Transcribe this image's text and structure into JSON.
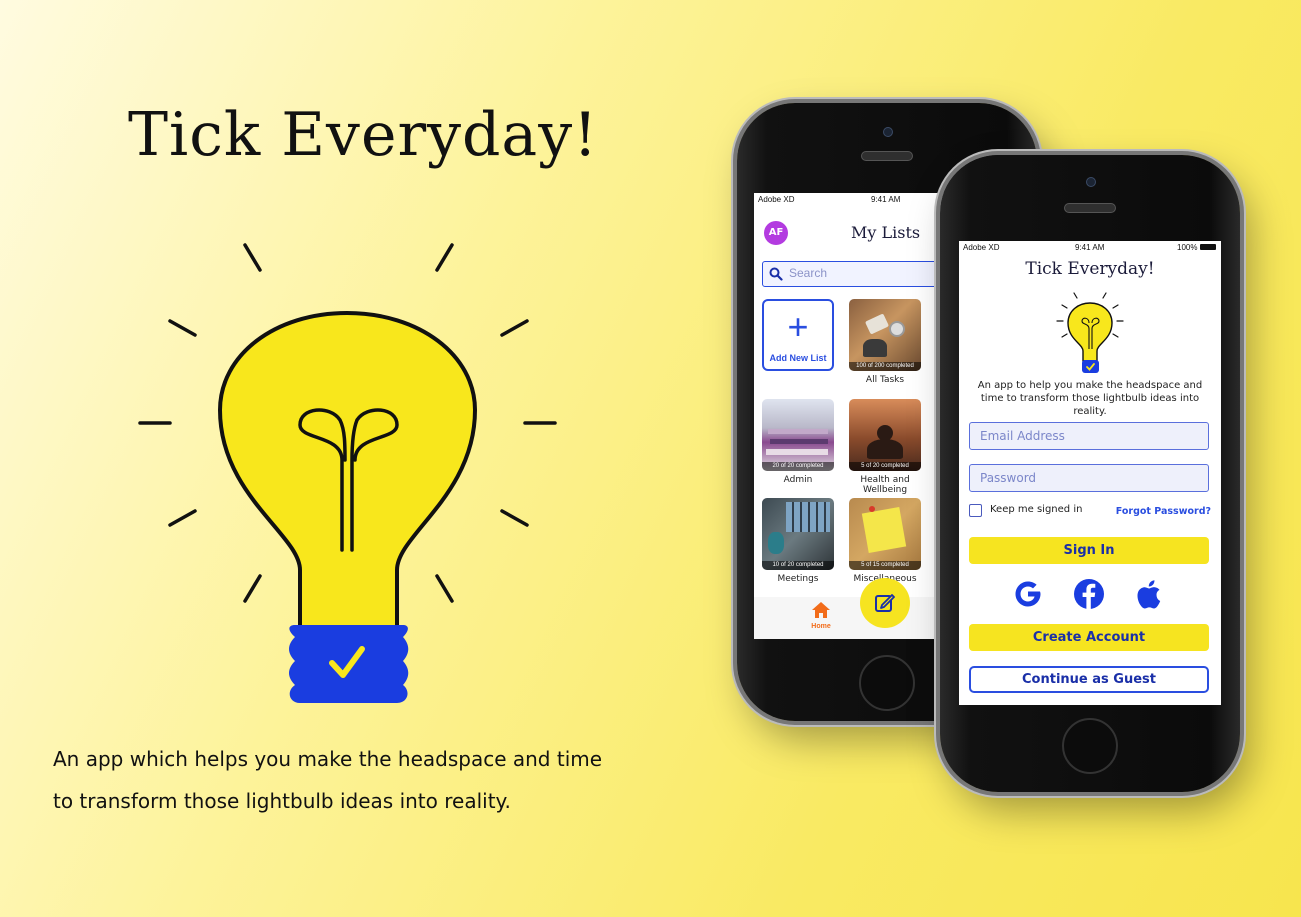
{
  "hero": {
    "title": "Tick Everyday!",
    "description_line1": "An app which helps you make the headspace and time",
    "description_line2": "to transform those lightbulb ideas into reality."
  },
  "colors": {
    "bulb_yellow": "#f8e71c",
    "bulb_base_blue": "#1a3de0",
    "accent_yellow": "#f6e420",
    "brand_blue": "#2a4ee0",
    "avatar_purple": "#b33be0",
    "home_orange": "#f26c1a"
  },
  "back_phone": {
    "status": {
      "carrier": "Adobe XD",
      "time": "9:41 AM"
    },
    "avatar_initials": "AF",
    "title": "My Lists",
    "search_placeholder": "Search",
    "add_new_list": "Add New List",
    "lists": [
      {
        "label": "All Tasks",
        "badge": "100 of 200 completed"
      },
      {
        "label": "Admin",
        "badge": "20 of 20 completed"
      },
      {
        "label": "Health and Wellbeing",
        "badge": "5 of 20 completed"
      },
      {
        "label": "Meetings",
        "badge": "10 of 20 completed"
      },
      {
        "label": "Miscellaneous",
        "badge": "5 of 15 completed"
      }
    ],
    "tab_home": "Home",
    "fab_icon": "edit-icon"
  },
  "front_phone": {
    "status": {
      "carrier": "Adobe XD",
      "time": "9:41 AM",
      "battery": "100%"
    },
    "title": "Tick Everyday!",
    "description": "An app to help you make the headspace and time to transform those lightbulb ideas into reality.",
    "email_placeholder": "Email Address",
    "password_placeholder": "Password",
    "keep_signed_in": "Keep me signed in",
    "forgot_password": "Forgot Password?",
    "sign_in": "Sign In",
    "social_icons": [
      "google-icon",
      "facebook-icon",
      "apple-icon"
    ],
    "create_account": "Create Account",
    "continue_guest": "Continue as Guest"
  }
}
